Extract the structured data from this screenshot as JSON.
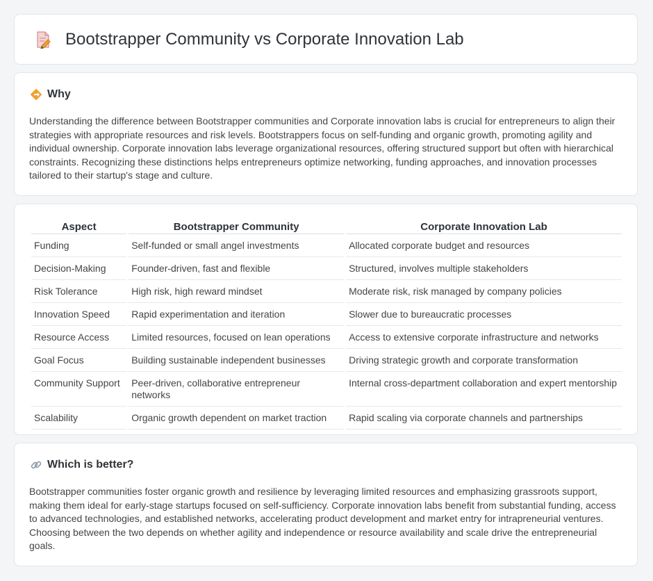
{
  "page_title": "Bootstrapper Community vs Corporate Innovation Lab",
  "why": {
    "heading": "Why",
    "body": "Understanding the difference between Bootstrapper communities and Corporate innovation labs is crucial for entrepreneurs to align their strategies with appropriate resources and risk levels. Bootstrappers focus on self-funding and organic growth, promoting agility and individual ownership. Corporate innovation labs leverage organizational resources, offering structured support but often with hierarchical constraints. Recognizing these distinctions helps entrepreneurs optimize networking, funding approaches, and innovation processes tailored to their startup's stage and culture."
  },
  "table": {
    "headers": [
      "Aspect",
      "Bootstrapper Community",
      "Corporate Innovation Lab"
    ],
    "rows": [
      [
        "Funding",
        "Self-funded or small angel investments",
        "Allocated corporate budget and resources"
      ],
      [
        "Decision-Making",
        "Founder-driven, fast and flexible",
        "Structured, involves multiple stakeholders"
      ],
      [
        "Risk Tolerance",
        "High risk, high reward mindset",
        "Moderate risk, risk managed by company policies"
      ],
      [
        "Innovation Speed",
        "Rapid experimentation and iteration",
        "Slower due to bureaucratic processes"
      ],
      [
        "Resource Access",
        "Limited resources, focused on lean operations",
        "Access to extensive corporate infrastructure and networks"
      ],
      [
        "Goal Focus",
        "Building sustainable independent businesses",
        "Driving strategic growth and corporate transformation"
      ],
      [
        "Community Support",
        "Peer-driven, collaborative entrepreneur networks",
        "Internal cross-department collaboration and expert mentorship"
      ],
      [
        "Scalability",
        "Organic growth dependent on market traction",
        "Rapid scaling via corporate channels and partnerships"
      ]
    ]
  },
  "better": {
    "heading": "Which is better?",
    "body": "Bootstrapper communities foster organic growth and resilience by leveraging limited resources and emphasizing grassroots support, making them ideal for early-stage startups focused on self-sufficiency. Corporate innovation labs benefit from substantial funding, access to advanced technologies, and established networks, accelerating product development and market entry for intrapreneurial ventures. Choosing between the two depends on whether agility and independence or resource availability and scale drive the entrepreneurial goals."
  },
  "icons": {
    "title": "document-pencil-icon",
    "why": "diamond-arrow-icon",
    "better": "link-icon"
  },
  "colors": {
    "background": "#f4f5f7",
    "card": "#ffffff",
    "accent_orange": "#f0a030",
    "icon_pink": "#e88a8a"
  }
}
